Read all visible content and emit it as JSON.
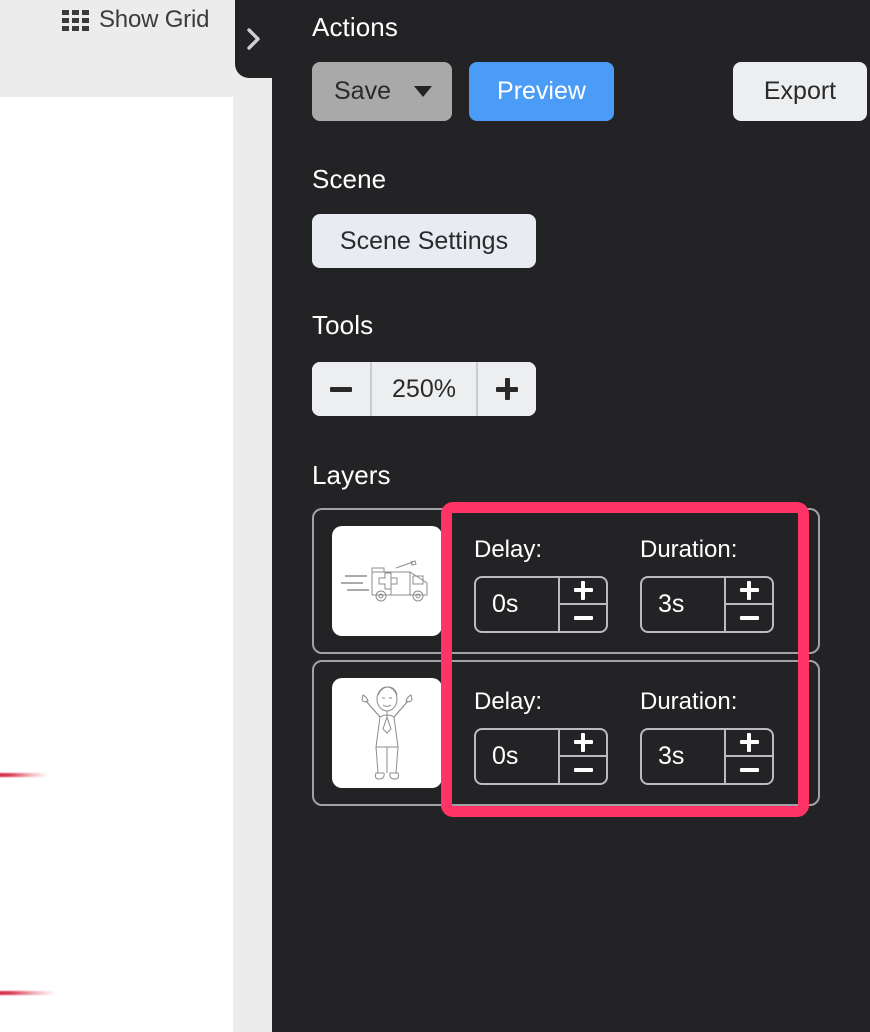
{
  "canvas": {
    "show_grid_label": "Show Grid",
    "grid_icon": "grid-icon"
  },
  "panel_toggle": {
    "icon": "chevron-right-icon"
  },
  "panel": {
    "sections": {
      "actions": {
        "title": "Actions",
        "save_label": "Save",
        "save_caret_icon": "chevron-down-icon",
        "preview_label": "Preview",
        "export_label": "Export"
      },
      "scene": {
        "title": "Scene",
        "scene_settings_label": "Scene Settings"
      },
      "tools": {
        "title": "Tools",
        "zoom_decrease_icon": "minus-icon",
        "zoom_value": "250%",
        "zoom_increase_icon": "plus-icon"
      },
      "layers": {
        "title": "Layers",
        "items": [
          {
            "thumbnail": "ambulance-thumbnail",
            "delay_label": "Delay:",
            "delay_value": "0s",
            "delay_increase_icon": "plus-icon",
            "delay_decrease_icon": "minus-icon",
            "duration_label": "Duration:",
            "duration_value": "3s",
            "duration_increase_icon": "plus-icon",
            "duration_decrease_icon": "minus-icon"
          },
          {
            "thumbnail": "cheering-person-thumbnail",
            "delay_label": "Delay:",
            "delay_value": "0s",
            "delay_increase_icon": "plus-icon",
            "delay_decrease_icon": "minus-icon",
            "duration_label": "Duration:",
            "duration_value": "3s",
            "duration_increase_icon": "plus-icon",
            "duration_decrease_icon": "minus-icon"
          }
        ]
      }
    }
  },
  "colors": {
    "panel_background": "#232325",
    "canvas_background": "#ffffff",
    "gutter": "#ececec",
    "preview_accent": "#4a9cf6",
    "save_disabled": "#a9a9a9",
    "light_button": "#eceef0",
    "highlight_border": "#ff3366",
    "card_border": "#9fa3a8"
  }
}
